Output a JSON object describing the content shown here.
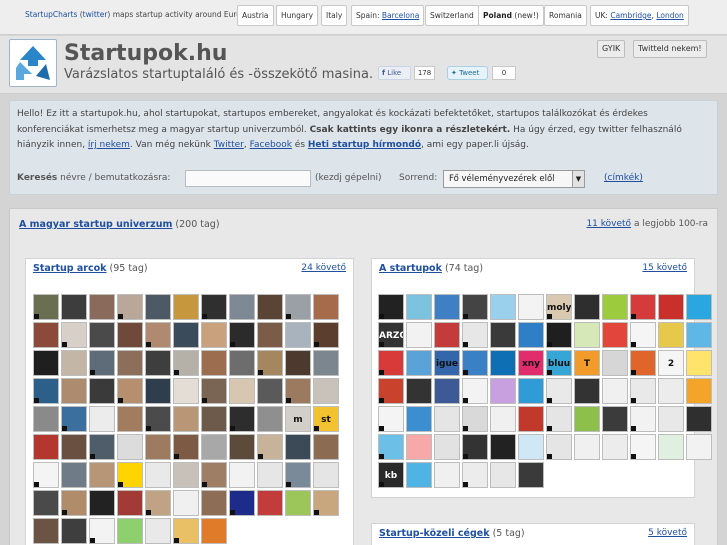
{
  "topbar": {
    "brand": "StartupCharts",
    "twitter": "twitter",
    "intro_rest": "maps startup activity around Europe:",
    "cities": [
      {
        "label": "Austria"
      },
      {
        "label": "Hungary"
      },
      {
        "label": "Italy"
      },
      {
        "prefix": "Spain:",
        "label": "Barcelona"
      },
      {
        "label": "Switzerland"
      },
      {
        "label": "Poland",
        "suffix": "(new!)"
      },
      {
        "label": "Romania"
      },
      {
        "prefix": "UK:",
        "label": "Cambridge",
        "sep": ",",
        "label2": "London"
      }
    ]
  },
  "header": {
    "title": "Startupok.hu",
    "tagline": "Varázslatos startuptaláló és -összekötő masina.",
    "fb_like": "Like",
    "fb_count": "178",
    "tweet": "Tweet",
    "tweet_count": "0",
    "faq_button": "GYIK",
    "tweet_us_button": "Twitteld nekem!"
  },
  "info": {
    "t1": "Hello! Ez itt a startupok.hu, ahol startupokat, startupos embereket, angyalokat és kockázati befektetőket, startupos találkozókat és érdekes konferenciákat ismerhetsz meg a magyar startup univerzumból. ",
    "bold1": "Csak kattints egy ikonra a részletekért.",
    "t2": " Ha úgy érzed, egy twitter felhasználó hiányzik innen, ",
    "link_write": "írj nekem",
    "t3": ". Van még nekünk ",
    "link_twitter": "Twitter",
    "t4": ", ",
    "link_facebook": "Facebook",
    "t5": " és ",
    "link_newsletter": "Heti startup hírmondó",
    "t6": ", ami egy paper.li újság."
  },
  "search": {
    "label_bold": "Keresés",
    "label_rest": "névre / bemutatkozásra:",
    "hint": "(kezdj gépelni)",
    "sort_label": "Sorrend:",
    "sort_value": "Fő véleményvezérek elől",
    "tags_link": "(címkék)"
  },
  "main": {
    "title_link": "A magyar startup univerzum",
    "title_count": "(200 tag)",
    "follow_link": "11 követő",
    "follow_rest": "a legjobb 100-ra"
  },
  "panels": {
    "faces": {
      "title": "Startup arcok",
      "count": "(95 tag)",
      "follow": "24 követő"
    },
    "startups": {
      "title": "A startupok",
      "count": "(74 tag)",
      "follow": "15 követő"
    },
    "companies": {
      "title": "Startup-közeli cégek",
      "count": "(5 tag)",
      "follow": "5 követő"
    }
  },
  "faces_tiles": [
    {
      "c": "#6b6f52"
    },
    {
      "c": "#3d3d3d"
    },
    {
      "c": "#8a6a5a"
    },
    {
      "c": "#b9a89a"
    },
    {
      "c": "#4d5a66"
    },
    {
      "c": "#c7973e"
    },
    {
      "c": "#2f2f2f"
    },
    {
      "c": "#7d8a96"
    },
    {
      "c": "#5a4436"
    },
    {
      "c": "#9aa0a6"
    },
    {
      "c": "#a66b4a"
    },
    {
      "c": "#8c4b3a"
    },
    {
      "c": "#d8d0c8"
    },
    {
      "c": "#4a4a4a"
    },
    {
      "c": "#6f4a3a"
    },
    {
      "c": "#b08a70"
    },
    {
      "c": "#3a4b5c"
    },
    {
      "c": "#c9a27d"
    },
    {
      "c": "#2b2b2b"
    },
    {
      "c": "#7a5c48"
    },
    {
      "c": "#a9b3bd"
    },
    {
      "c": "#5b3e2e"
    },
    {
      "c": "#1f1f1f"
    },
    {
      "c": "#c4b6a6"
    },
    {
      "c": "#5e6b78"
    },
    {
      "c": "#8d6e5a"
    },
    {
      "c": "#3e3e3e"
    },
    {
      "c": "#b5b0a8"
    },
    {
      "c": "#9c6d4e"
    },
    {
      "c": "#6d6d6d"
    },
    {
      "c": "#a5875f"
    },
    {
      "c": "#4d3a2e"
    },
    {
      "c": "#7c868f"
    },
    {
      "c": "#2c5f8a"
    },
    {
      "c": "#ad8b6f"
    },
    {
      "c": "#3a3a3a"
    },
    {
      "c": "#b58f6e"
    },
    {
      "c": "#2f3e4c"
    },
    {
      "c": "#e3ddd6"
    },
    {
      "c": "#7a6555"
    },
    {
      "c": "#d7c6b0"
    },
    {
      "c": "#5a5a5a"
    },
    {
      "c": "#9b7a60"
    },
    {
      "c": "#c8c2bb"
    },
    {
      "c": "#8a8a8a"
    },
    {
      "c": "#3b6f9e"
    },
    {
      "c": "#ececec"
    },
    {
      "c": "#a27c5f"
    },
    {
      "c": "#4b4b4b"
    },
    {
      "c": "#b89676"
    },
    {
      "c": "#6e5a4b"
    },
    {
      "c": "#2d2d2d"
    },
    {
      "c": "#8f8f8f"
    },
    {
      "c": "#d2cfc9",
      "t": "m"
    },
    {
      "c": "#f2c230",
      "t": "st"
    },
    {
      "c": "#b3372f"
    },
    {
      "c": "#6a5040"
    },
    {
      "c": "#4f5d6b"
    },
    {
      "c": "#dcdcdc"
    },
    {
      "c": "#9d7b61"
    },
    {
      "c": "#7c5a44"
    },
    {
      "c": "#a8a8a8"
    },
    {
      "c": "#5c4a3b"
    },
    {
      "c": "#c7b29a"
    },
    {
      "c": "#3c4a57"
    },
    {
      "c": "#8b6b52"
    },
    {
      "c": "#f4f4f4"
    },
    {
      "c": "#6f7c88"
    },
    {
      "c": "#b69677"
    },
    {
      "c": "#ffd400"
    },
    {
      "c": "#e9e9e9"
    },
    {
      "c": "#c7c1ba"
    },
    {
      "c": "#9e7f66"
    },
    {
      "c": "#f2f2f2"
    },
    {
      "c": "#e6e6e6"
    },
    {
      "c": "#7b8a99"
    },
    {
      "c": "#e5e5e5"
    },
    {
      "c": "#4a4a4a"
    },
    {
      "c": "#b18c6a"
    },
    {
      "c": "#222222"
    },
    {
      "c": "#a23a35"
    },
    {
      "c": "#c0a285"
    },
    {
      "c": "#f0f0f0"
    },
    {
      "c": "#8e6d55"
    },
    {
      "c": "#1d2b8a"
    },
    {
      "c": "#c23c3c"
    },
    {
      "c": "#9cc65a"
    },
    {
      "c": "#c9a77e"
    },
    {
      "c": "#6b5444"
    },
    {
      "c": "#3e3e3e"
    },
    {
      "c": "#f3f3f3"
    },
    {
      "c": "#8fd06e"
    },
    {
      "c": "#e9e9e9"
    },
    {
      "c": "#e9c066"
    },
    {
      "c": "#e07b2a"
    }
  ],
  "startup_tiles": [
    {
      "c": "#222222"
    },
    {
      "c": "#7cc3e0"
    },
    {
      "c": "#3f80c4"
    },
    {
      "c": "#444444"
    },
    {
      "c": "#9bd0ec"
    },
    {
      "c": "#f3f3f3"
    },
    {
      "c": "#d9c9b0",
      "t": "moly"
    },
    {
      "c": "#2e2e2e"
    },
    {
      "c": "#9ccc3d"
    },
    {
      "c": "#d63b3b"
    },
    {
      "c": "#c9302c"
    },
    {
      "c": "#2aa7e0"
    },
    {
      "c": "#333333",
      "t": "ARZO"
    },
    {
      "c": "#f2f2f2"
    },
    {
      "c": "#c43b3b"
    },
    {
      "c": "#e7e7e7"
    },
    {
      "c": "#3a3a3a"
    },
    {
      "c": "#2f7fc8"
    },
    {
      "c": "#1f1f1f"
    },
    {
      "c": "#d7e8b8"
    },
    {
      "c": "#e2463b"
    },
    {
      "c": "#f5f5f5"
    },
    {
      "c": "#e6c84a"
    },
    {
      "c": "#5fb7e5"
    },
    {
      "c": "#d83a3a"
    },
    {
      "c": "#5aa3d6"
    },
    {
      "c": "#3366aa",
      "t": "igue"
    },
    {
      "c": "#3a80c4"
    },
    {
      "c": "#0f6fb5"
    },
    {
      "c": "#e12d6b",
      "t": "xny"
    },
    {
      "c": "#35a6d6",
      "t": "bluu"
    },
    {
      "c": "#f29b2a",
      "t": "T"
    },
    {
      "c": "#d6d6d6"
    },
    {
      "c": "#e0652a"
    },
    {
      "c": "#f5f5f5",
      "t": "2"
    },
    {
      "c": "#ffe36b"
    },
    {
      "c": "#c9432c"
    },
    {
      "c": "#333333"
    },
    {
      "c": "#3d5a96"
    },
    {
      "c": "#f3f3f3"
    },
    {
      "c": "#c8a0e0"
    },
    {
      "c": "#2f9bd7"
    },
    {
      "c": "#e9e9e9"
    },
    {
      "c": "#333333"
    },
    {
      "c": "#f0f0f0"
    },
    {
      "c": "#e9e9e9"
    },
    {
      "c": "#ececec"
    },
    {
      "c": "#f5a42a"
    },
    {
      "c": "#f4f4f4"
    },
    {
      "c": "#3b8fd0"
    },
    {
      "c": "#e5e5e5"
    },
    {
      "c": "#d9d9d9"
    },
    {
      "c": "#f0f0f0"
    },
    {
      "c": "#c0392b"
    },
    {
      "c": "#e5e5e5"
    },
    {
      "c": "#8cc04a"
    },
    {
      "c": "#3b3b3b"
    },
    {
      "c": "#f2f2f2"
    },
    {
      "c": "#e8e8e8"
    },
    {
      "c": "#2f2f2f"
    },
    {
      "c": "#6cc0e8"
    },
    {
      "c": "#f7a8a8"
    },
    {
      "c": "#e2e2e2"
    },
    {
      "c": "#333333"
    },
    {
      "c": "#222222"
    },
    {
      "c": "#d0e8f5"
    },
    {
      "c": "#e5e5e5"
    },
    {
      "c": "#f0f0f0"
    },
    {
      "c": "#ececec"
    },
    {
      "c": "#f5f5f5"
    },
    {
      "c": "#e0f0e0"
    },
    {
      "c": "#f2f2f2"
    },
    {
      "c": "#2a2a2a",
      "t": "kb"
    },
    {
      "c": "#4fb3e3"
    },
    {
      "c": "#f0f0f0"
    },
    {
      "c": "#ececec"
    },
    {
      "c": "#e7e7e7"
    },
    {
      "c": "#3a3a3a"
    }
  ]
}
